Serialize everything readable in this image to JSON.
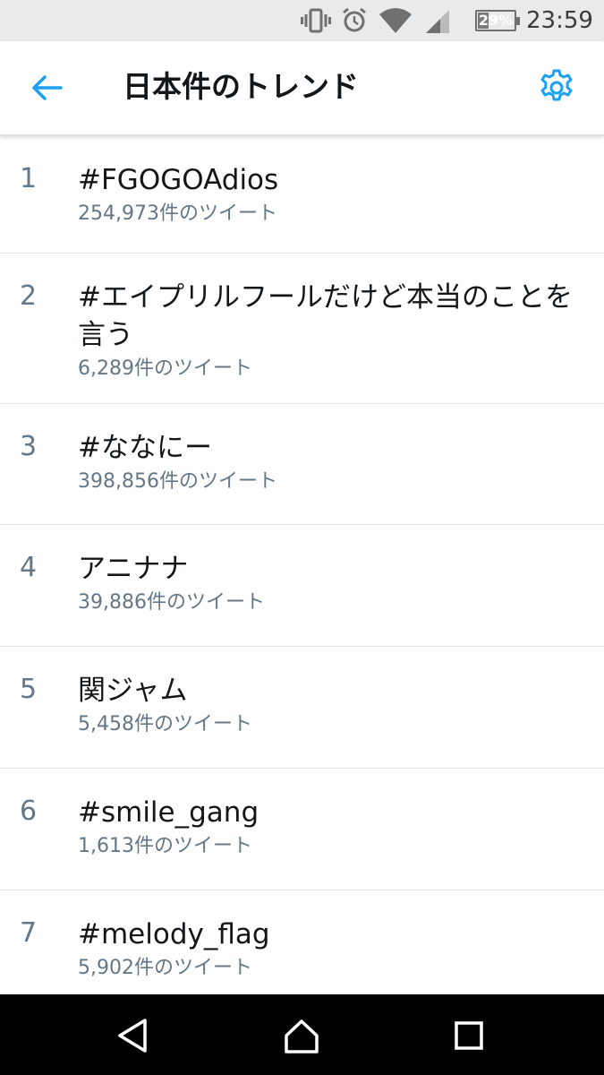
{
  "status_bar": {
    "time": "23:59",
    "battery_percent": "29%",
    "battery_level": 0.29,
    "icons": [
      "vibrate-icon",
      "alarm-clock-icon",
      "wifi-icon",
      "cell-signal-icon",
      "battery-icon"
    ]
  },
  "header": {
    "title": "日本件のトレンド",
    "back_icon": "back-arrow-icon",
    "settings_icon": "gear-icon"
  },
  "trends": [
    {
      "rank": "1",
      "name": "#FGOGOAdios",
      "count": "254,973件のツイート"
    },
    {
      "rank": "2",
      "name": "#エイプリルフールだけど本当のことを言う",
      "count": "6,289件のツイート"
    },
    {
      "rank": "3",
      "name": "#ななにー",
      "count": "398,856件のツイート"
    },
    {
      "rank": "4",
      "name": "アニナナ",
      "count": "39,886件のツイート"
    },
    {
      "rank": "5",
      "name": "関ジャム",
      "count": "5,458件のツイート"
    },
    {
      "rank": "6",
      "name": "#smile_gang",
      "count": "1,613件のツイート"
    },
    {
      "rank": "7",
      "name": "#melody_flag",
      "count": "5,902件のツイート"
    }
  ],
  "nav_bar": {
    "icons": [
      "nav-back-icon",
      "nav-home-icon",
      "nav-recents-icon"
    ]
  },
  "colors": {
    "accent": "#1da1f2",
    "text_primary": "#14171a",
    "text_secondary": "#657786",
    "divider": "#e1e8ed"
  }
}
